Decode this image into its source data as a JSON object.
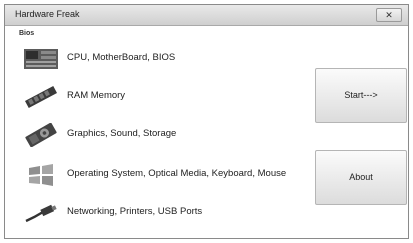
{
  "window": {
    "title": "Hardware Freak"
  },
  "group": {
    "label": "Bios"
  },
  "items": [
    {
      "label": "CPU, MotherBoard, BIOS",
      "icon": "motherboard-icon"
    },
    {
      "label": "RAM Memory",
      "icon": "ram-icon"
    },
    {
      "label": "Graphics, Sound, Storage",
      "icon": "graphics-card-icon"
    },
    {
      "label": "Operating System, Optical Media, Keyboard, Mouse",
      "icon": "windows-logo-icon"
    },
    {
      "label": "Networking, Printers, USB Ports",
      "icon": "network-cable-icon"
    }
  ],
  "buttons": {
    "start": "Start--->",
    "about": "About"
  }
}
